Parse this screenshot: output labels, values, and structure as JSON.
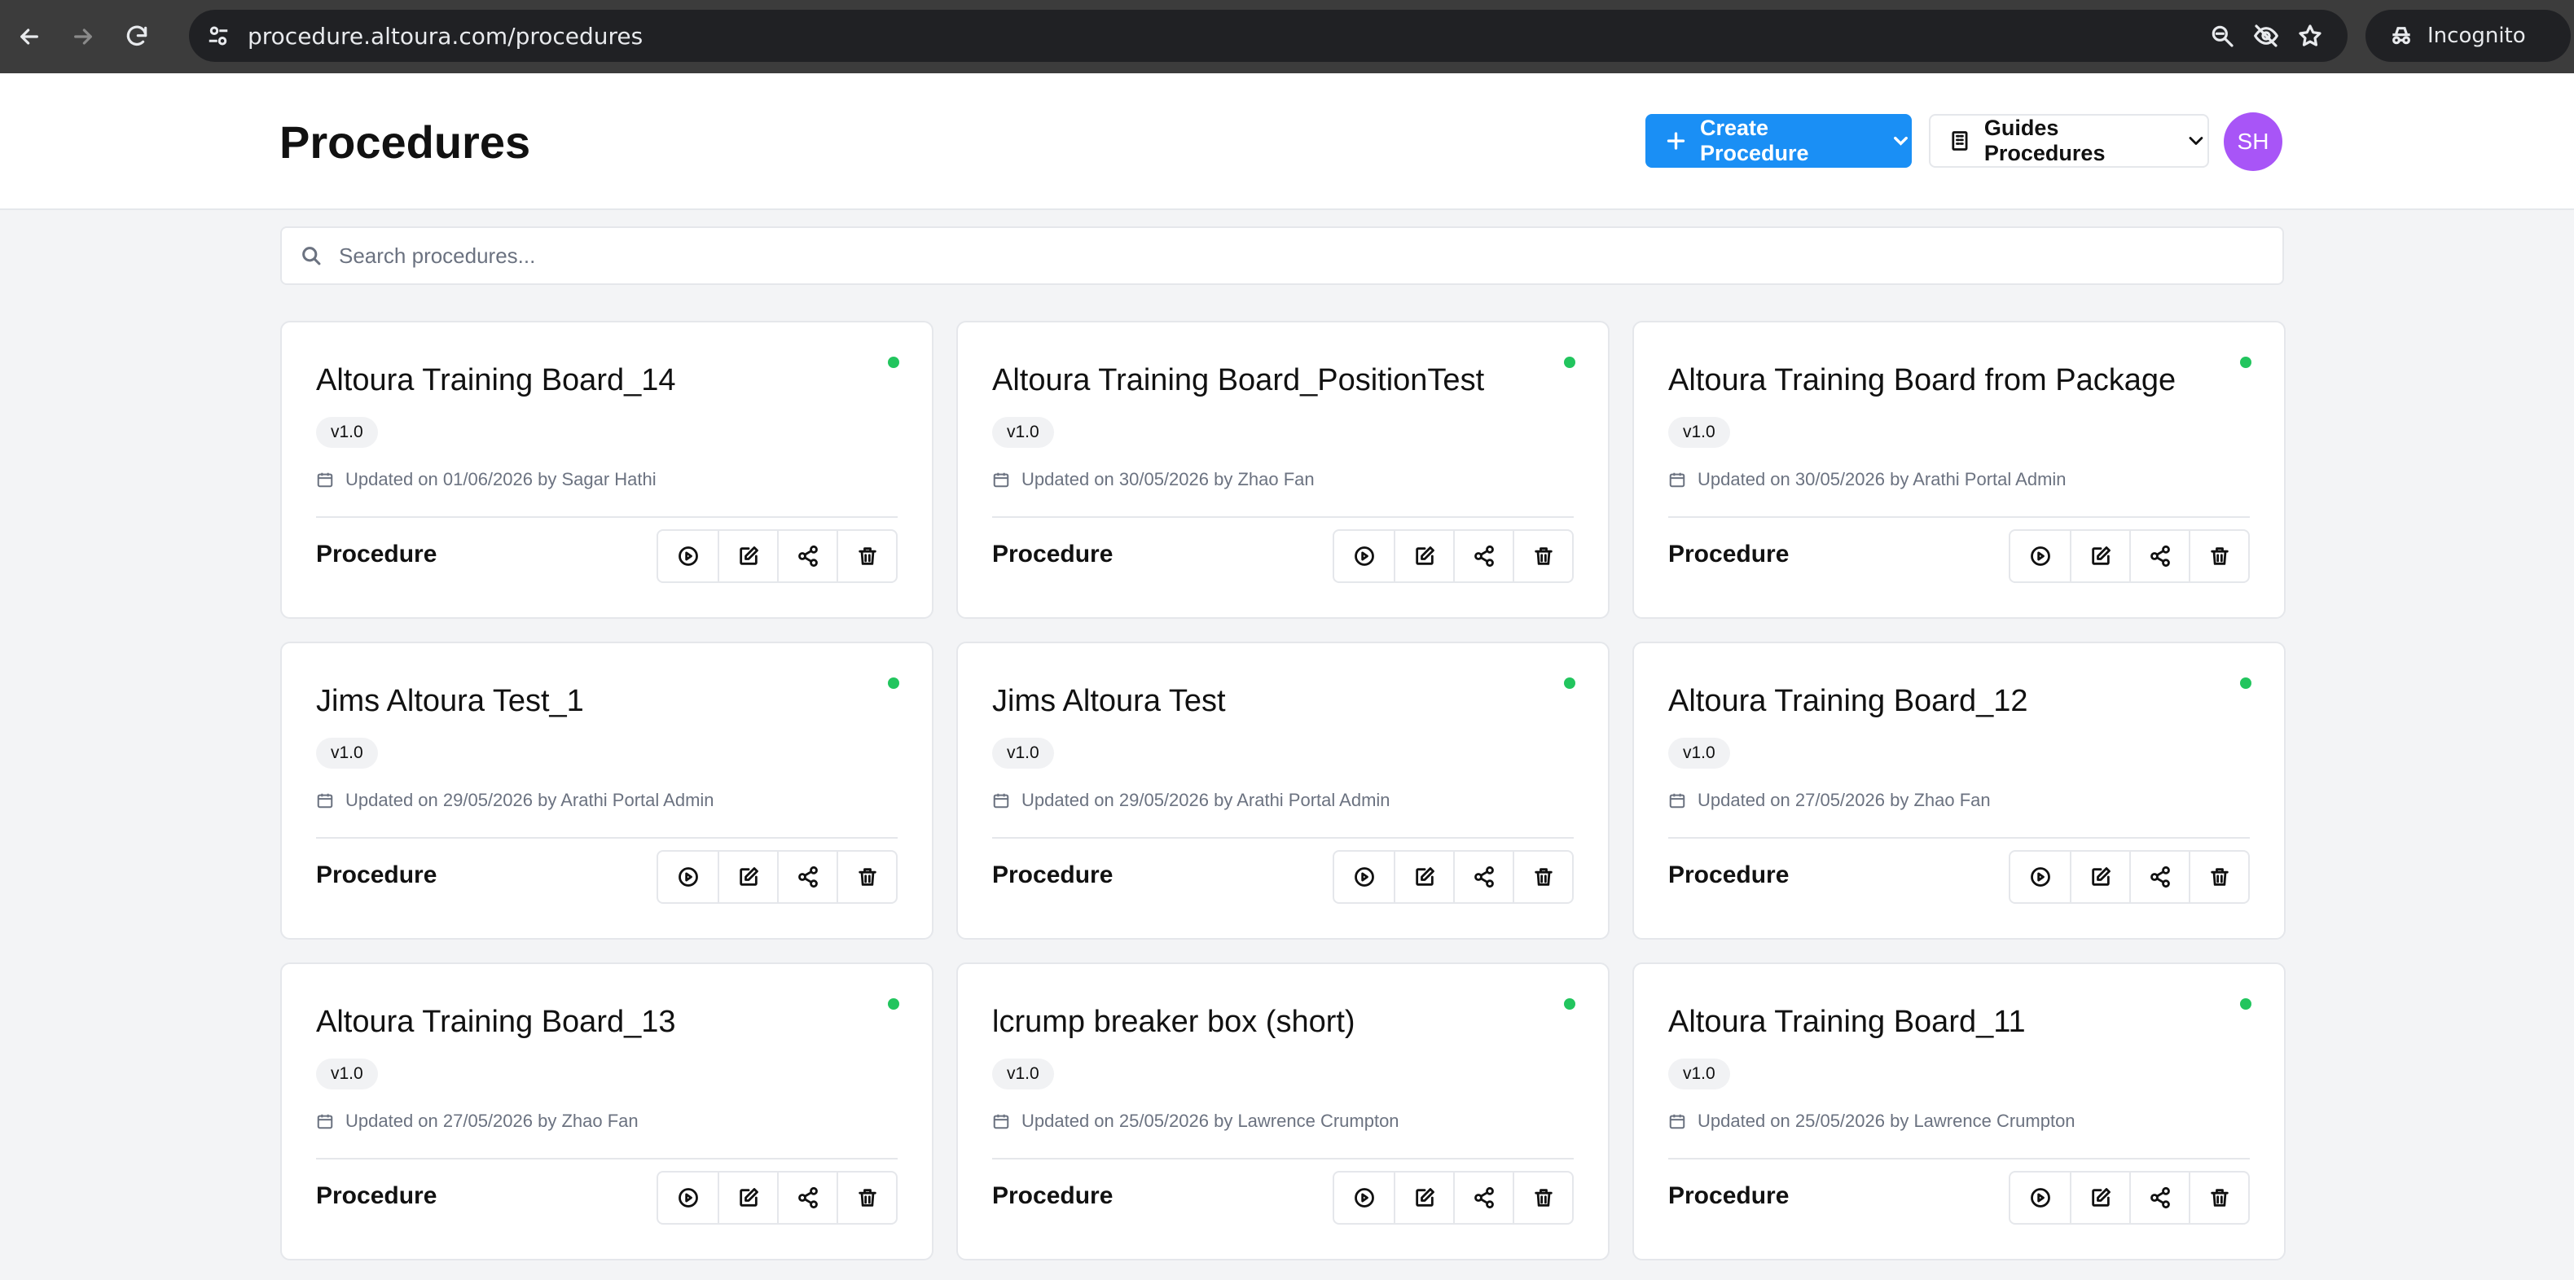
{
  "browser": {
    "url": "procedure.altoura.com/procedures",
    "incognito_label": "Incognito"
  },
  "header": {
    "title": "Procedures",
    "create_button_label": "Create Procedure",
    "guides_button_label": "Guides Procedures",
    "avatar_initials": "SH",
    "accent_color": "#1a8ff5",
    "avatar_color": "#a855f7"
  },
  "search": {
    "placeholder": "Search procedures..."
  },
  "cards": [
    {
      "title": "Altoura Training Board_14",
      "version": "v1.0",
      "updated": "Updated on 01/06/2026 by Sagar Hathi",
      "type": "Procedure",
      "status_color": "#22c55e"
    },
    {
      "title": "Altoura Training Board_PositionTest",
      "version": "v1.0",
      "updated": "Updated on 30/05/2026 by Zhao Fan",
      "type": "Procedure",
      "status_color": "#22c55e"
    },
    {
      "title": "Altoura Training Board from Package",
      "version": "v1.0",
      "updated": "Updated on 30/05/2026 by Arathi Portal Admin",
      "type": "Procedure",
      "status_color": "#22c55e"
    },
    {
      "title": "Jims Altoura Test_1",
      "version": "v1.0",
      "updated": "Updated on 29/05/2026 by Arathi Portal Admin",
      "type": "Procedure",
      "status_color": "#22c55e"
    },
    {
      "title": "Jims Altoura Test",
      "version": "v1.0",
      "updated": "Updated on 29/05/2026 by Arathi Portal Admin",
      "type": "Procedure",
      "status_color": "#22c55e"
    },
    {
      "title": "Altoura Training Board_12",
      "version": "v1.0",
      "updated": "Updated on 27/05/2026 by Zhao Fan",
      "type": "Procedure",
      "status_color": "#22c55e"
    },
    {
      "title": "Altoura Training Board_13",
      "version": "v1.0",
      "updated": "Updated on 27/05/2026 by Zhao Fan",
      "type": "Procedure",
      "status_color": "#22c55e"
    },
    {
      "title": "lcrump breaker box (short)",
      "version": "v1.0",
      "updated": "Updated on 25/05/2026 by Lawrence Crumpton",
      "type": "Procedure",
      "status_color": "#22c55e"
    },
    {
      "title": "Altoura Training Board_11",
      "version": "v1.0",
      "updated": "Updated on 25/05/2026 by Lawrence Crumpton",
      "type": "Procedure",
      "status_color": "#22c55e"
    }
  ],
  "card_actions": [
    "play-icon",
    "edit-icon",
    "share-icon",
    "trash-icon"
  ]
}
